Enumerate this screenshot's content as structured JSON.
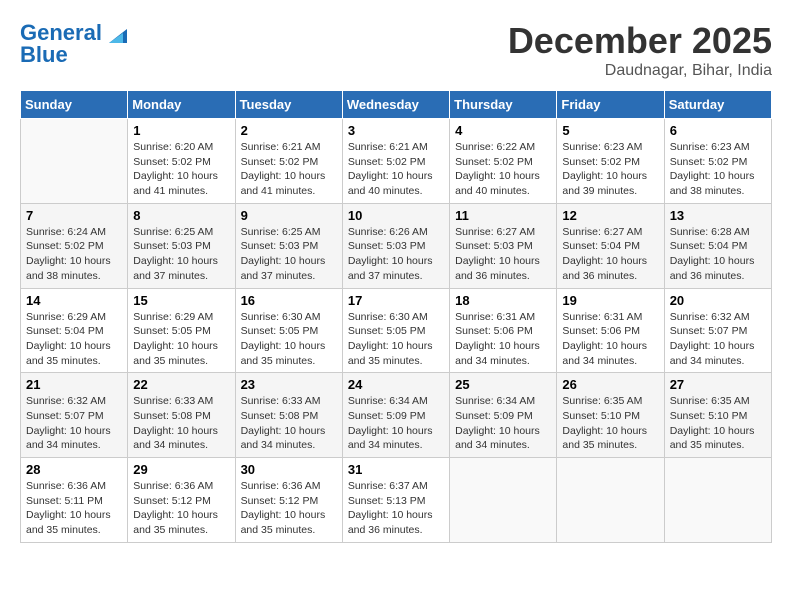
{
  "header": {
    "logo_line1": "General",
    "logo_line2": "Blue",
    "month": "December 2025",
    "location": "Daudnagar, Bihar, India"
  },
  "weekdays": [
    "Sunday",
    "Monday",
    "Tuesday",
    "Wednesday",
    "Thursday",
    "Friday",
    "Saturday"
  ],
  "weeks": [
    [
      {
        "day": "",
        "text": ""
      },
      {
        "day": "1",
        "text": "Sunrise: 6:20 AM\nSunset: 5:02 PM\nDaylight: 10 hours\nand 41 minutes."
      },
      {
        "day": "2",
        "text": "Sunrise: 6:21 AM\nSunset: 5:02 PM\nDaylight: 10 hours\nand 41 minutes."
      },
      {
        "day": "3",
        "text": "Sunrise: 6:21 AM\nSunset: 5:02 PM\nDaylight: 10 hours\nand 40 minutes."
      },
      {
        "day": "4",
        "text": "Sunrise: 6:22 AM\nSunset: 5:02 PM\nDaylight: 10 hours\nand 40 minutes."
      },
      {
        "day": "5",
        "text": "Sunrise: 6:23 AM\nSunset: 5:02 PM\nDaylight: 10 hours\nand 39 minutes."
      },
      {
        "day": "6",
        "text": "Sunrise: 6:23 AM\nSunset: 5:02 PM\nDaylight: 10 hours\nand 38 minutes."
      }
    ],
    [
      {
        "day": "7",
        "text": "Sunrise: 6:24 AM\nSunset: 5:02 PM\nDaylight: 10 hours\nand 38 minutes."
      },
      {
        "day": "8",
        "text": "Sunrise: 6:25 AM\nSunset: 5:03 PM\nDaylight: 10 hours\nand 37 minutes."
      },
      {
        "day": "9",
        "text": "Sunrise: 6:25 AM\nSunset: 5:03 PM\nDaylight: 10 hours\nand 37 minutes."
      },
      {
        "day": "10",
        "text": "Sunrise: 6:26 AM\nSunset: 5:03 PM\nDaylight: 10 hours\nand 37 minutes."
      },
      {
        "day": "11",
        "text": "Sunrise: 6:27 AM\nSunset: 5:03 PM\nDaylight: 10 hours\nand 36 minutes."
      },
      {
        "day": "12",
        "text": "Sunrise: 6:27 AM\nSunset: 5:04 PM\nDaylight: 10 hours\nand 36 minutes."
      },
      {
        "day": "13",
        "text": "Sunrise: 6:28 AM\nSunset: 5:04 PM\nDaylight: 10 hours\nand 36 minutes."
      }
    ],
    [
      {
        "day": "14",
        "text": "Sunrise: 6:29 AM\nSunset: 5:04 PM\nDaylight: 10 hours\nand 35 minutes."
      },
      {
        "day": "15",
        "text": "Sunrise: 6:29 AM\nSunset: 5:05 PM\nDaylight: 10 hours\nand 35 minutes."
      },
      {
        "day": "16",
        "text": "Sunrise: 6:30 AM\nSunset: 5:05 PM\nDaylight: 10 hours\nand 35 minutes."
      },
      {
        "day": "17",
        "text": "Sunrise: 6:30 AM\nSunset: 5:05 PM\nDaylight: 10 hours\nand 35 minutes."
      },
      {
        "day": "18",
        "text": "Sunrise: 6:31 AM\nSunset: 5:06 PM\nDaylight: 10 hours\nand 34 minutes."
      },
      {
        "day": "19",
        "text": "Sunrise: 6:31 AM\nSunset: 5:06 PM\nDaylight: 10 hours\nand 34 minutes."
      },
      {
        "day": "20",
        "text": "Sunrise: 6:32 AM\nSunset: 5:07 PM\nDaylight: 10 hours\nand 34 minutes."
      }
    ],
    [
      {
        "day": "21",
        "text": "Sunrise: 6:32 AM\nSunset: 5:07 PM\nDaylight: 10 hours\nand 34 minutes."
      },
      {
        "day": "22",
        "text": "Sunrise: 6:33 AM\nSunset: 5:08 PM\nDaylight: 10 hours\nand 34 minutes."
      },
      {
        "day": "23",
        "text": "Sunrise: 6:33 AM\nSunset: 5:08 PM\nDaylight: 10 hours\nand 34 minutes."
      },
      {
        "day": "24",
        "text": "Sunrise: 6:34 AM\nSunset: 5:09 PM\nDaylight: 10 hours\nand 34 minutes."
      },
      {
        "day": "25",
        "text": "Sunrise: 6:34 AM\nSunset: 5:09 PM\nDaylight: 10 hours\nand 34 minutes."
      },
      {
        "day": "26",
        "text": "Sunrise: 6:35 AM\nSunset: 5:10 PM\nDaylight: 10 hours\nand 35 minutes."
      },
      {
        "day": "27",
        "text": "Sunrise: 6:35 AM\nSunset: 5:10 PM\nDaylight: 10 hours\nand 35 minutes."
      }
    ],
    [
      {
        "day": "28",
        "text": "Sunrise: 6:36 AM\nSunset: 5:11 PM\nDaylight: 10 hours\nand 35 minutes."
      },
      {
        "day": "29",
        "text": "Sunrise: 6:36 AM\nSunset: 5:12 PM\nDaylight: 10 hours\nand 35 minutes."
      },
      {
        "day": "30",
        "text": "Sunrise: 6:36 AM\nSunset: 5:12 PM\nDaylight: 10 hours\nand 35 minutes."
      },
      {
        "day": "31",
        "text": "Sunrise: 6:37 AM\nSunset: 5:13 PM\nDaylight: 10 hours\nand 36 minutes."
      },
      {
        "day": "",
        "text": ""
      },
      {
        "day": "",
        "text": ""
      },
      {
        "day": "",
        "text": ""
      }
    ]
  ]
}
